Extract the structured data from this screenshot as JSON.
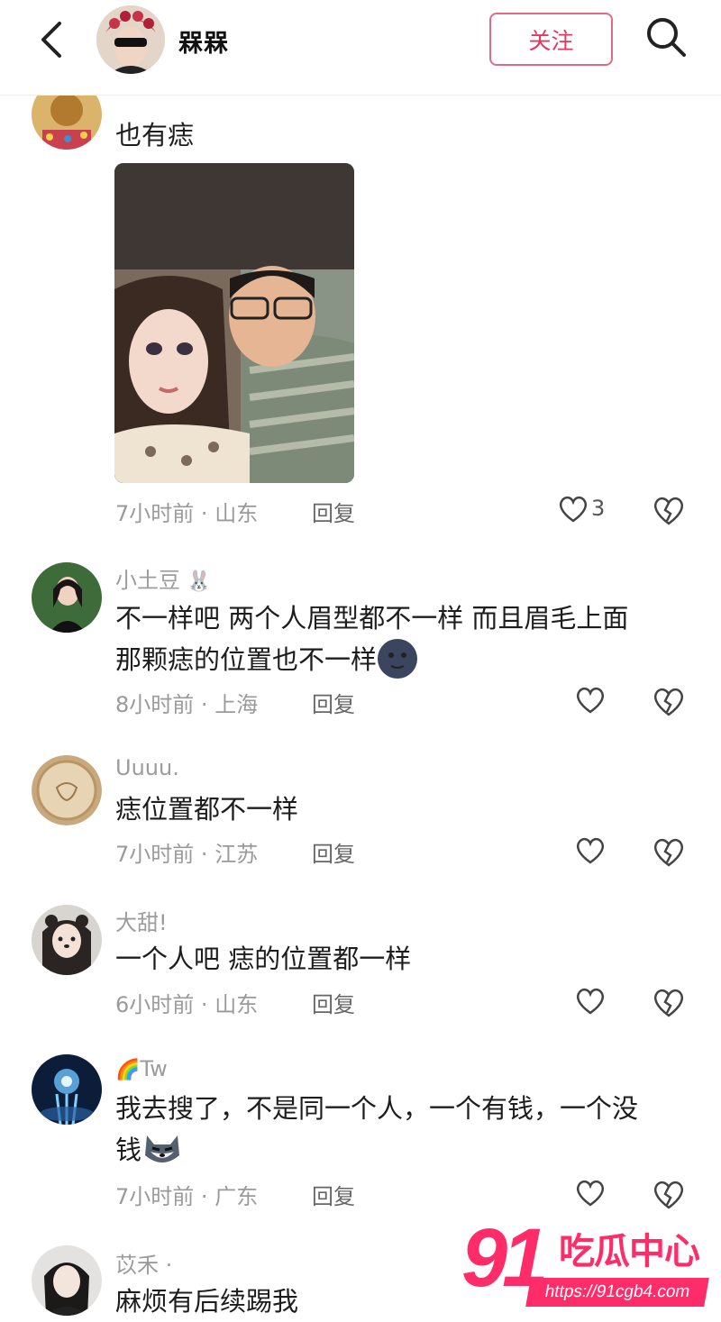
{
  "header": {
    "username": "槑槑",
    "follow_label": "关注"
  },
  "comments": [
    {
      "text": "也有痣",
      "time": "7小时前",
      "location": "山东",
      "reply_label": "回复",
      "likes": "3"
    },
    {
      "username": "小土豆",
      "text_line1": "不一样吧 两个人眉型都不一样 而且眉毛上面",
      "text_line2": "那颗痣的位置也不一样",
      "time": "8小时前",
      "location": "上海",
      "reply_label": "回复"
    },
    {
      "username": "Uuuu.",
      "text": "痣位置都不一样",
      "time": "7小时前",
      "location": "江苏",
      "reply_label": "回复"
    },
    {
      "username": "大甜!",
      "text": "一个人吧  痣的位置都一样",
      "time": "6小时前",
      "location": "山东",
      "reply_label": "回复"
    },
    {
      "username": "Tw",
      "text_line1": "我去搜了，不是同一个人，一个有钱，一个没",
      "text_line2": "钱",
      "time": "7小时前",
      "location": "广东",
      "reply_label": "回复"
    },
    {
      "username": "苡禾 ·",
      "text": "麻烦有后续踢我"
    }
  ],
  "separator": "·",
  "watermark": {
    "number": "91",
    "name": "吃瓜中心",
    "url": "https://91cgb4.com"
  },
  "colors": {
    "accent": "#e0395f",
    "watermark": "#ff2c6a"
  },
  "icons": [
    "back-arrow-icon",
    "search-icon",
    "heart-icon",
    "broken-heart-icon",
    "rabbit-emoji",
    "dark-moon-emoji",
    "husky-emoji",
    "rainbow-emoji"
  ]
}
